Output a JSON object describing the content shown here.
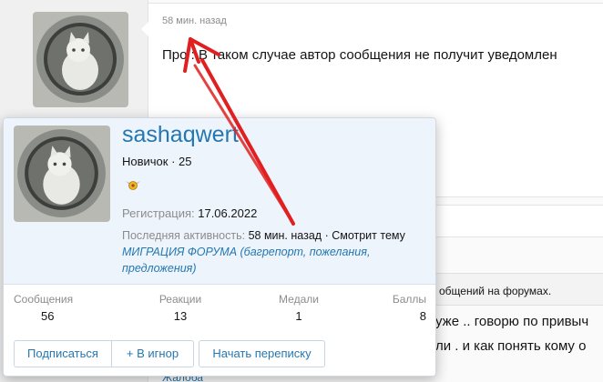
{
  "post": {
    "time": "58 мин. назад",
    "text": "Про : В таком случае автор сообщения не получит уведомлен"
  },
  "background": {
    "notice_text": "общений на форумах.",
    "line1": "уже .. говорю по привыч",
    "line2": "ли . и как понять кому о",
    "complaint_link": "Жалоба"
  },
  "member_tooltip": {
    "username": "sashaqwert",
    "user_title": "Новичок · 25",
    "badge_icon": "winged-medal-icon",
    "registration_label": "Регистрация:",
    "registration_date": "17.06.2022",
    "activity_label": "Последняя активность:",
    "activity_time": "58 мин. назад",
    "activity_viewing": "· Смотрит тему",
    "activity_thread": "МИГРАЦИЯ ФОРУМА (багрепорт, пожелания, предложения)",
    "stats": [
      {
        "label": "Сообщения",
        "value": "56"
      },
      {
        "label": "Реакции",
        "value": "13"
      },
      {
        "label": "Медали",
        "value": "1"
      },
      {
        "label": "Баллы",
        "value": "8"
      }
    ],
    "buttons": {
      "follow": "Подписаться",
      "ignore": "+ В игнор",
      "message": "Начать переписку"
    }
  },
  "colors": {
    "link": "#2577b1",
    "tooltip_header_bg": "#edf4fb",
    "annotation_arrow": "#e02020"
  }
}
